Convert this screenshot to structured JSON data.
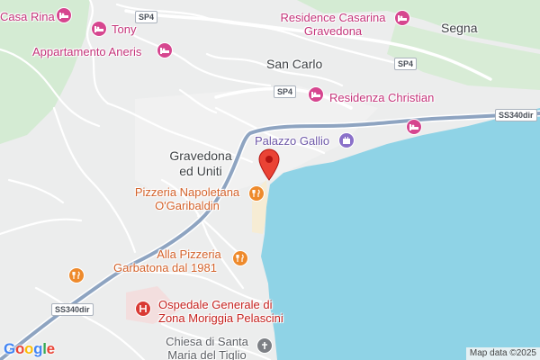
{
  "map": {
    "water_color": "#8fd3e6",
    "land_color": "#eceded",
    "forest_color": "#d0e8d0",
    "highway_color": "#8ea4c1"
  },
  "places": [
    {
      "name": "Casa Rina",
      "kind": "hotel",
      "icon": "bed-icon"
    },
    {
      "name": "Tony",
      "kind": "hotel",
      "icon": "bed-icon"
    },
    {
      "name": "Appartamento Aneris",
      "kind": "hotel",
      "icon": "bed-icon"
    },
    {
      "name": "Residence Casarina Gravedona",
      "kind": "hotel",
      "icon": "bed-icon"
    },
    {
      "name": "Residenza Christian",
      "kind": "hotel",
      "icon": "bed-icon"
    },
    {
      "name": "Palazzo Gallio",
      "kind": "landmark",
      "icon": "castle-icon"
    },
    {
      "name": "Pizzeria Napoletana O'Garibaldin",
      "kind": "restaurant",
      "icon": "fork-knife-icon"
    },
    {
      "name": "Alla Pizzeria Garbatona dal 1981",
      "kind": "restaurant",
      "icon": "fork-knife-icon"
    },
    {
      "name": "Ospedale Generale di Zona Moriggia Pelascini",
      "kind": "hospital",
      "icon": "hospital-icon"
    },
    {
      "name": "Chiesa di Santa Maria del Tiglio",
      "kind": "church",
      "icon": "cross-icon"
    }
  ],
  "labels": {
    "casa_rina": "Casa Rina",
    "tony": "Tony",
    "aneris": "Appartamento Aneris",
    "casarina_1": "Residence Casarina",
    "casarina_2": "Gravedona",
    "christian": "Residenza Christian",
    "gallio": "Palazzo Gallio",
    "pizzeria_1": "Pizzeria Napoletana",
    "pizzeria_2": "O'Garibaldin",
    "garbatona_1": "Alla Pizzeria",
    "garbatona_2": "Garbatona dal 1981",
    "hospital_1": "Ospedale Generale di",
    "hospital_2": "Zona Moriggia Pelascini",
    "church_1": "Chiesa di Santa",
    "church_2": "Maria del Tiglio",
    "segna": "Segna",
    "san_carlo": "San Carlo",
    "gravedona_1": "Gravedona",
    "gravedona_2": "ed Uniti"
  },
  "roads": {
    "sp4_a": "SP4",
    "sp4_b": "SP4",
    "sp4_c": "SP4",
    "ss340_east": "SS340dir",
    "ss340_west": "SS340dir"
  },
  "footer": {
    "logo": "Google",
    "attribution": "Map data ©2025"
  }
}
